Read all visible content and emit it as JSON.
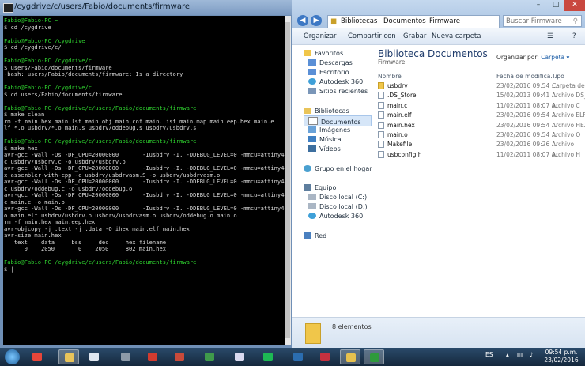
{
  "terminal": {
    "title": "/cygdrive/c/users/Fabio/documents/firmware",
    "lines": [
      {
        "t": "Fabio@Fabio-PC ~",
        "c": "g"
      },
      {
        "t": "$ cd /cygdrive",
        "c": ""
      },
      {
        "t": "",
        "c": ""
      },
      {
        "t": "Fabio@Fabio-PC /cygdrive",
        "c": "g"
      },
      {
        "t": "$ cd /cygdrive/c/",
        "c": ""
      },
      {
        "t": "",
        "c": ""
      },
      {
        "t": "Fabio@Fabio-PC /cygdrive/c",
        "c": "g"
      },
      {
        "t": "$ users/Fabio/documents/firmware",
        "c": ""
      },
      {
        "t": "-bash: users/Fabio/documents/firmware: Is a directory",
        "c": ""
      },
      {
        "t": "",
        "c": ""
      },
      {
        "t": "Fabio@Fabio-PC /cygdrive/c",
        "c": "g"
      },
      {
        "t": "$ cd users/Fabio/documents/firmware",
        "c": ""
      },
      {
        "t": "",
        "c": ""
      },
      {
        "t": "Fabio@Fabio-PC /cygdrive/c/users/Fabio/documents/firmware",
        "c": "g"
      },
      {
        "t": "$ make clean",
        "c": ""
      },
      {
        "t": "rm -f main.hex main.lst main.obj main.cof main.list main.map main.eep.hex main.e",
        "c": ""
      },
      {
        "t": "lf *.o usbdrv/*.o main.s usbdrv/oddebug.s usbdrv/usbdrv.s",
        "c": ""
      },
      {
        "t": "",
        "c": ""
      },
      {
        "t": "Fabio@Fabio-PC /cygdrive/c/users/Fabio/documents/firmware",
        "c": "g"
      },
      {
        "t": "$ make hex",
        "c": ""
      },
      {
        "t": "avr-gcc -Wall -Os -DF_CPU=20000000       -Iusbdrv -I. -DDEBUG_LEVEL=0 -mmcu=attiny44 -",
        "c": ""
      },
      {
        "t": "c usbdrv/usbdrv.c -o usbdrv/usbdrv.o",
        "c": ""
      },
      {
        "t": "avr-gcc -Wall -Os -DF_CPU=20000000       -Iusbdrv -I. -DDEBUG_LEVEL=0 -mmcu=attiny44 -",
        "c": ""
      },
      {
        "t": "x assembler-with-cpp -c usbdrv/usbdrvasm.S -o usbdrv/usbdrvasm.o",
        "c": ""
      },
      {
        "t": "avr-gcc -Wall -Os -DF_CPU=20000000       -Iusbdrv -I. -DDEBUG_LEVEL=0 -mmcu=attiny44 -",
        "c": ""
      },
      {
        "t": "c usbdrv/oddebug.c -o usbdrv/oddebug.o",
        "c": ""
      },
      {
        "t": "avr-gcc -Wall -Os -DF_CPU=20000000       -Iusbdrv -I. -DDEBUG_LEVEL=0 -mmcu=attiny44 -",
        "c": ""
      },
      {
        "t": "c main.c -o main.o",
        "c": ""
      },
      {
        "t": "avr-gcc -Wall -Os -DF_CPU=20000000       -Iusbdrv -I. -DDEBUG_LEVEL=0 -mmcu=attiny44 -",
        "c": ""
      },
      {
        "t": "o main.elf usbdrv/usbdrv.o usbdrv/usbdrvasm.o usbdrv/oddebug.o main.o",
        "c": ""
      },
      {
        "t": "rm -f main.hex main.eep.hex",
        "c": ""
      },
      {
        "t": "avr-objcopy -j .text -j .data -O ihex main.elf main.hex",
        "c": ""
      },
      {
        "t": "avr-size main.hex",
        "c": ""
      },
      {
        "t": "   text    data     bss     dec     hex filename",
        "c": ""
      },
      {
        "t": "      0    2050       0    2050     802 main.hex",
        "c": ""
      },
      {
        "t": "",
        "c": ""
      },
      {
        "t": "Fabio@Fabio-PC /cygdrive/c/users/Fabio/documents/firmware",
        "c": "g"
      },
      {
        "t": "$ |",
        "c": ""
      }
    ]
  },
  "explorer": {
    "breadcrumb": [
      "Bibliotecas",
      "Documentos",
      "Firmware"
    ],
    "search_placeholder": "Buscar Firmware",
    "toolbar": [
      "Organizar",
      "Compartir con",
      "Grabar",
      "Nueva carpeta"
    ],
    "nav": {
      "favorites_header": "Favoritos",
      "favorites": [
        "Descargas",
        "Escritorio",
        "Autodesk 360",
        "Sitios recientes"
      ],
      "libraries_header": "Bibliotecas",
      "libraries": [
        "Documentos",
        "Imágenes",
        "Música",
        "Vídeos"
      ],
      "homegroup": "Grupo en el hogar",
      "computer_header": "Equipo",
      "computer": [
        "Disco local (C:)",
        "Disco local (D:)",
        "Autodesk 360"
      ],
      "network": "Red"
    },
    "library_title": "Biblioteca Documentos",
    "library_subtitle": "Firmware",
    "arrange_label": "Organizar por:",
    "arrange_value": "Carpeta",
    "columns": [
      "Nombre",
      "Fecha de modifica...",
      "Tipo"
    ],
    "files": [
      {
        "name": "usbdrv",
        "date": "23/02/2016 09:54 ...",
        "type": "Carpeta de a",
        "folder": true
      },
      {
        "name": ".DS_Store",
        "date": "15/02/2013 09:41 ...",
        "type": "Archivo DS_",
        "folder": false
      },
      {
        "name": "main.c",
        "date": "11/02/2011 08:07 a...",
        "type": "Archivo C",
        "folder": false
      },
      {
        "name": "main.elf",
        "date": "23/02/2016 09:54 ...",
        "type": "Archivo ELF",
        "folder": false
      },
      {
        "name": "main.hex",
        "date": "23/02/2016 09:54 ...",
        "type": "Archivo HEX",
        "folder": false
      },
      {
        "name": "main.o",
        "date": "23/02/2016 09:54 ...",
        "type": "Archivo O",
        "folder": false
      },
      {
        "name": "Makefile",
        "date": "23/02/2016 09:26 ...",
        "type": "Archivo",
        "folder": false
      },
      {
        "name": "usbconfig.h",
        "date": "11/02/2011 08:07 a...",
        "type": "Archivo H",
        "folder": false
      }
    ],
    "status": "8 elementos"
  },
  "taskbar": {
    "language": "ES",
    "time": "09:54 p.m.",
    "date": "23/02/2016",
    "apps": [
      {
        "name": "chrome",
        "color": "#e8463a"
      },
      {
        "name": "file-explorer",
        "color": "#e9c45a"
      },
      {
        "name": "notepad",
        "color": "#dfe6ef"
      },
      {
        "name": "calculator",
        "color": "#8d9aa8"
      },
      {
        "name": "autocad",
        "color": "#d23b2f"
      },
      {
        "name": "sketchup",
        "color": "#c94a3a"
      },
      {
        "name": "eagle",
        "color": "#3f9a4b"
      },
      {
        "name": "itunes",
        "color": "#d9d9ef"
      },
      {
        "name": "spotify",
        "color": "#1db954"
      },
      {
        "name": "photoshop",
        "color": "#2b6db0"
      },
      {
        "name": "media",
        "color": "#c5313f"
      },
      {
        "name": "explorer-active",
        "color": "#e7c14e"
      },
      {
        "name": "cygwin-terminal",
        "color": "#2f9a3c"
      }
    ]
  }
}
